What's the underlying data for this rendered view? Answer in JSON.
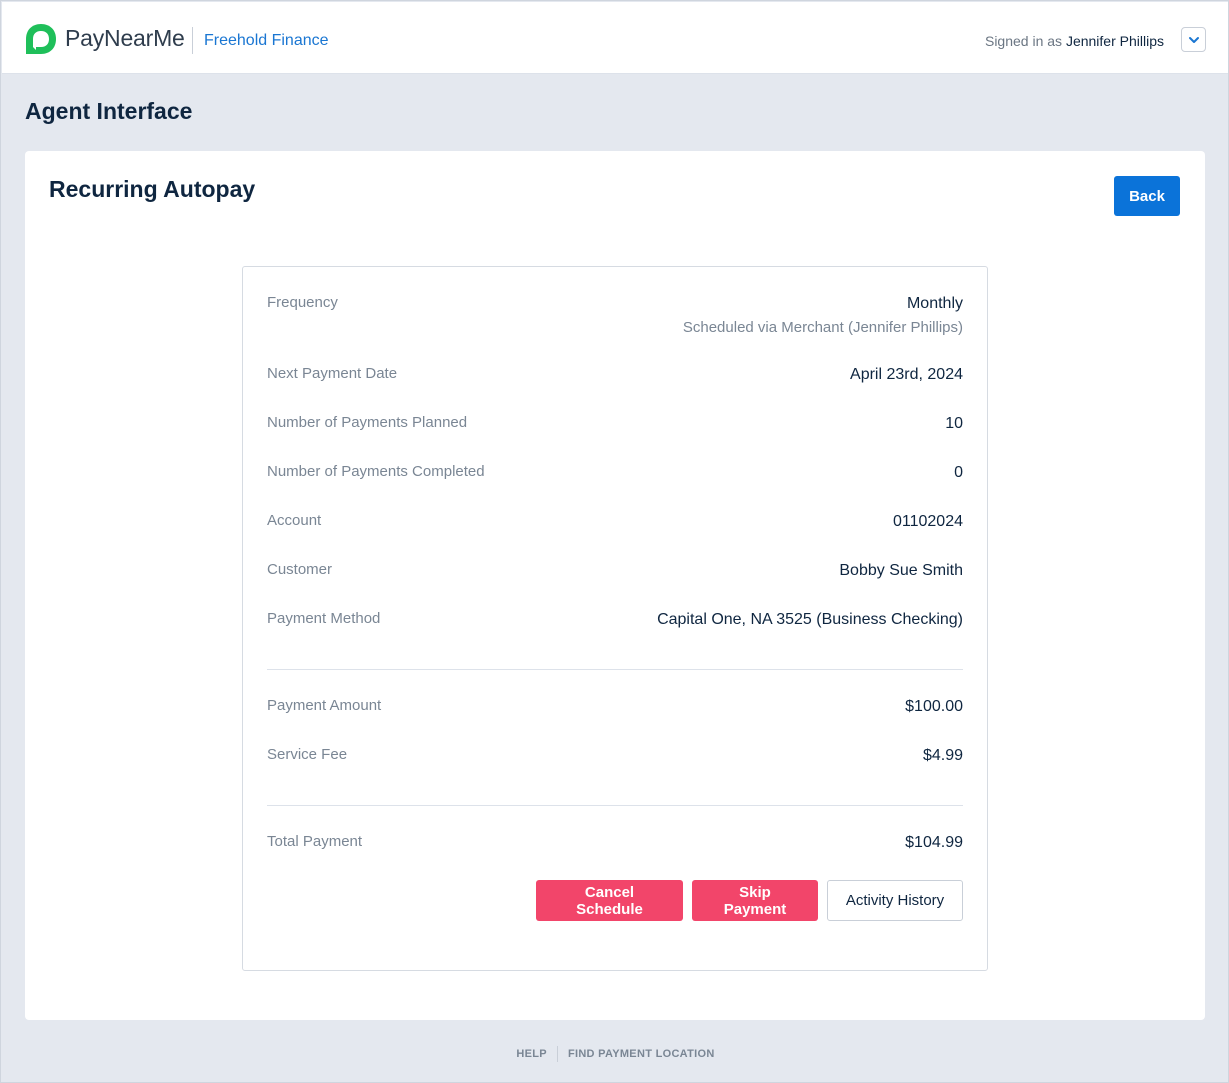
{
  "header": {
    "brand": "PayNearMe",
    "merchant": "Freehold Finance",
    "signed_in_prefix": "Signed in as",
    "user_name": "Jennifer Phillips"
  },
  "page": {
    "title": "Agent Interface",
    "card_title": "Recurring Autopay",
    "back_label": "Back"
  },
  "details": [
    {
      "label": "Frequency",
      "value": "Monthly",
      "sub": "Scheduled via Merchant (Jennifer Phillips)"
    },
    {
      "label": "Next Payment Date",
      "value": "April 23rd, 2024"
    },
    {
      "label": "Number of Payments Planned",
      "value": "10"
    },
    {
      "label": "Number of Payments Completed",
      "value": "0"
    },
    {
      "label": "Account",
      "value": "01102024"
    },
    {
      "label": "Customer",
      "value": "Bobby Sue Smith"
    },
    {
      "label": "Payment Method",
      "value": "Capital One, NA 3525 (Business Checking)"
    }
  ],
  "amounts": [
    {
      "label": "Payment Amount",
      "value": "$100.00"
    },
    {
      "label": "Service Fee",
      "value": "$4.99"
    }
  ],
  "total": {
    "label": "Total Payment",
    "value": "$104.99"
  },
  "actions": {
    "cancel": "Cancel Schedule",
    "skip": "Skip Payment",
    "history": "Activity History"
  },
  "footer": {
    "help": "HELP",
    "find_location": "FIND PAYMENT LOCATION"
  },
  "colors": {
    "brand_green": "#1fbf5a",
    "link_blue": "#1a76d2",
    "primary_button": "#0b73d9",
    "danger_button": "#f2456a"
  }
}
